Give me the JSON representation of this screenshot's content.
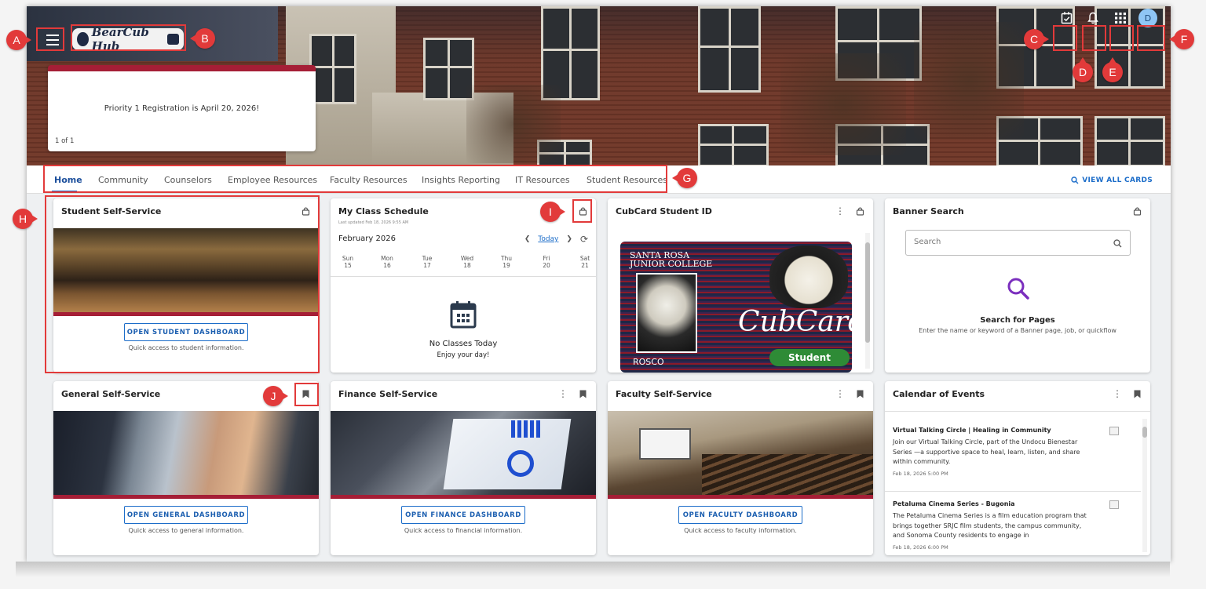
{
  "header": {
    "logo_text": "BearCub Hub",
    "banner_message": "Priority 1 Registration is April 20, 2026!",
    "banner_pager": "1 of 1",
    "avatar_initial": "D",
    "icons": [
      "menu-icon",
      "task-checklist-icon",
      "bell-icon",
      "apps-grid-icon"
    ]
  },
  "tabs": [
    "Home",
    "Community",
    "Counselors",
    "Employee Resources",
    "Faculty Resources",
    "Insights Reporting",
    "IT Resources",
    "Student Resources"
  ],
  "active_tab": "Home",
  "view_all_label": "VIEW ALL CARDS",
  "cards": {
    "student": {
      "title": "Student Self-Service",
      "button": "OPEN STUDENT DASHBOARD",
      "sub": "Quick access to student information."
    },
    "schedule": {
      "title": "My Class Schedule",
      "updated": "Last updated Feb 18, 2026 9:55 AM",
      "month": "February 2026",
      "today_label": "Today",
      "days": [
        {
          "name": "Sun",
          "num": "15"
        },
        {
          "name": "Mon",
          "num": "16"
        },
        {
          "name": "Tue",
          "num": "17"
        },
        {
          "name": "Wed",
          "num": "18"
        },
        {
          "name": "Thu",
          "num": "19"
        },
        {
          "name": "Fri",
          "num": "20"
        },
        {
          "name": "Sat",
          "num": "21"
        }
      ],
      "selected_day": "Wed",
      "empty_title": "No Classes Today",
      "empty_sub": "Enjoy your day!"
    },
    "cubcard": {
      "title": "CubCard Student ID",
      "college": "SANTA ROSA\nJUNIOR COLLEGE",
      "brand": "CubCard",
      "role": "Student",
      "name": "ROSCO"
    },
    "banner_search": {
      "title": "Banner Search",
      "placeholder": "Search",
      "heading": "Search for Pages",
      "description": "Enter the name or keyword of a Banner page, job, or quickflow"
    },
    "general": {
      "title": "General Self-Service",
      "button": "OPEN GENERAL DASHBOARD",
      "sub": "Quick access to general information."
    },
    "finance": {
      "title": "Finance Self-Service",
      "button": "OPEN FINANCE DASHBOARD",
      "sub": "Quick access to financial information."
    },
    "faculty": {
      "title": "Faculty Self-Service",
      "button": "OPEN FACULTY DASHBOARD",
      "sub": "Quick access to faculty information."
    },
    "events": {
      "title": "Calendar of Events",
      "items": [
        {
          "title": "Virtual Talking Circle | Healing in Community",
          "body": "Join our Virtual Talking Circle, part of the Undocu Bienestar Series —a supportive space to heal, learn, listen, and share within community.",
          "date": "Feb 18, 2026 5:00 PM"
        },
        {
          "title": "Petaluma Cinema Series - Bugonia",
          "body": "The Petaluma Cinema Series is a film education program that brings together SRJC film students, the campus community, and Sonoma County residents to engage in",
          "date": "Feb 18, 2026 6:00 PM"
        }
      ]
    }
  },
  "annotations": [
    "A",
    "B",
    "C",
    "D",
    "E",
    "F",
    "G",
    "H",
    "I",
    "J"
  ],
  "colors": {
    "accent_red": "#a51e36",
    "link_blue": "#1c6dc9",
    "callout_red": "#e23a3a",
    "avatar_blue": "#8fc6f5",
    "search_purple": "#7b2fbe"
  }
}
